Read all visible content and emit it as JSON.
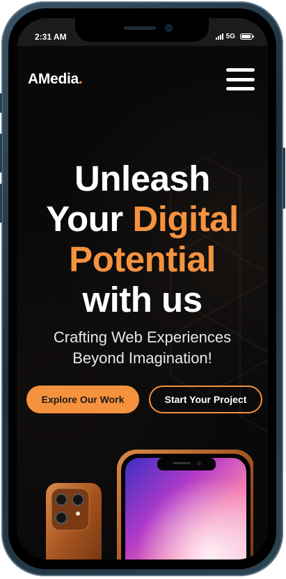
{
  "status_bar": {
    "time": "2:31 AM",
    "network": "5G"
  },
  "header": {
    "brand_name": "AMedia",
    "brand_dot": ".",
    "menu_icon": "hamburger-menu-icon"
  },
  "hero": {
    "headline": {
      "line1": "Unleash",
      "line2_plain": "Your ",
      "line2_accent": "Digital",
      "line3_accent": "Potential",
      "line4": "with us"
    },
    "subtitle": {
      "line1": "Crafting Web Experiences",
      "line2": "Beyond Imagination!"
    },
    "primary_button": "Explore Our Work",
    "secondary_button": "Start Your Project"
  },
  "colors": {
    "accent": "#f5923e",
    "background": "#0a0909",
    "text": "#ffffff"
  }
}
